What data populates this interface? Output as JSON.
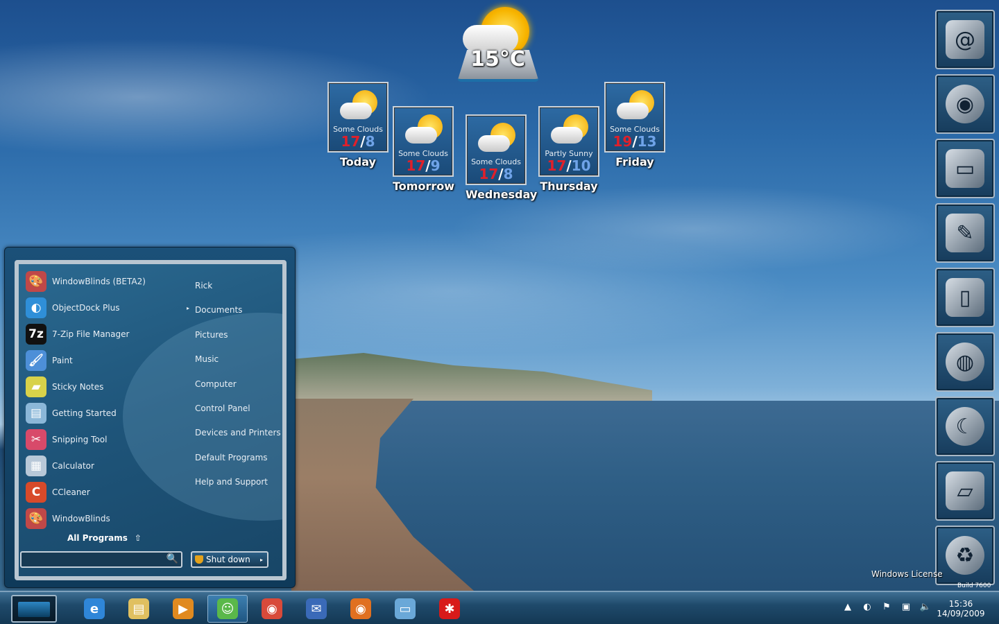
{
  "weather": {
    "current_temp": "15°C",
    "forecast": [
      {
        "condition": "Some Clouds",
        "high": "17",
        "low": "8",
        "day": "Today"
      },
      {
        "condition": "Some Clouds",
        "high": "17",
        "low": "9",
        "day": "Tomorrow"
      },
      {
        "condition": "Some Clouds",
        "high": "17",
        "low": "8",
        "day": "Wednesday"
      },
      {
        "condition": "Partly Sunny",
        "high": "17",
        "low": "10",
        "day": "Thursday"
      },
      {
        "condition": "Some Clouds",
        "high": "19",
        "low": "13",
        "day": "Friday"
      }
    ],
    "separator": "/"
  },
  "dock": {
    "items": [
      {
        "icon": "mail-icon",
        "glyph": "@"
      },
      {
        "icon": "firefox-icon",
        "glyph": "◉"
      },
      {
        "icon": "monitor-icon",
        "glyph": "▭"
      },
      {
        "icon": "pen-icon",
        "glyph": "✎"
      },
      {
        "icon": "door-icon",
        "glyph": "▯"
      },
      {
        "icon": "globe-icon",
        "glyph": "◍"
      },
      {
        "icon": "moon-orbs-icon",
        "glyph": "☾"
      },
      {
        "icon": "drive-icon",
        "glyph": "▱"
      },
      {
        "icon": "recycle-bin-icon",
        "glyph": "♻"
      }
    ]
  },
  "desktop": {
    "license_text": "Windows License",
    "build_text": "Build 7600"
  },
  "start_menu": {
    "apps": [
      {
        "label": "WindowBlinds (BETA2)",
        "icon": "windowblinds-icon",
        "glyph": "🎨",
        "color": "#c04848",
        "has_arrow": false
      },
      {
        "label": "ObjectDock Plus",
        "icon": "objectdock-icon",
        "glyph": "◐",
        "color": "#2f8fd8",
        "has_arrow": true
      },
      {
        "label": "7-Zip File Manager",
        "icon": "7zip-icon",
        "glyph": "7z",
        "color": "#111111",
        "has_arrow": false
      },
      {
        "label": "Paint",
        "icon": "paint-icon",
        "glyph": "🖌",
        "color": "#4d8fd8",
        "has_arrow": false
      },
      {
        "label": "Sticky Notes",
        "icon": "sticky-notes-icon",
        "glyph": "▰",
        "color": "#d8d24a",
        "has_arrow": false
      },
      {
        "label": "Getting Started",
        "icon": "getting-started-icon",
        "glyph": "▤",
        "color": "#8bb7d8",
        "has_arrow": false
      },
      {
        "label": "Snipping Tool",
        "icon": "snipping-tool-icon",
        "glyph": "✂",
        "color": "#d84a6a",
        "has_arrow": false
      },
      {
        "label": "Calculator",
        "icon": "calculator-icon",
        "glyph": "▦",
        "color": "#b8c8d8",
        "has_arrow": false
      },
      {
        "label": "CCleaner",
        "icon": "ccleaner-icon",
        "glyph": "C",
        "color": "#d84a2a",
        "has_arrow": false
      },
      {
        "label": "WindowBlinds",
        "icon": "windowblinds-icon",
        "glyph": "🎨",
        "color": "#c04848",
        "has_arrow": false
      }
    ],
    "all_programs": "All Programs",
    "all_programs_arrow": "⇧",
    "places": [
      "Rick",
      "Documents",
      "Pictures",
      "Music",
      "Computer",
      "Control Panel",
      "Devices and Printers",
      "Default Programs",
      "Help and Support"
    ],
    "search_value": "",
    "search_icon": "🔍",
    "shutdown_label": "Shut down",
    "shutdown_arrow": "▸",
    "submenu_arrow": "▸"
  },
  "taskbar": {
    "buttons": [
      {
        "icon": "internet-explorer-icon",
        "glyph": "e",
        "color": "#2f86d8",
        "active": false
      },
      {
        "icon": "file-explorer-icon",
        "glyph": "▤",
        "color": "#e0c060",
        "active": false
      },
      {
        "icon": "media-player-icon",
        "glyph": "▶",
        "color": "#e08a20",
        "active": false
      },
      {
        "icon": "messenger-icon",
        "glyph": "☺",
        "color": "#5ab84a",
        "active": true
      },
      {
        "icon": "chrome-icon",
        "glyph": "◉",
        "color": "#d84a3a",
        "active": false
      },
      {
        "icon": "thunderbird-icon",
        "glyph": "✉",
        "color": "#3a6ab8",
        "active": false
      },
      {
        "icon": "firefox-icon",
        "glyph": "◉",
        "color": "#e07020",
        "active": false
      },
      {
        "icon": "remote-desktop-icon",
        "glyph": "▭",
        "color": "#6aa8d8",
        "active": false
      },
      {
        "icon": "splat-icon",
        "glyph": "✱",
        "color": "#d81a1a",
        "active": false
      }
    ],
    "tray": [
      {
        "icon": "show-hidden-icon",
        "glyph": "▲"
      },
      {
        "icon": "objectdock-tray-icon",
        "glyph": "◐"
      },
      {
        "icon": "action-center-flag-icon",
        "glyph": "⚑"
      },
      {
        "icon": "network-icon",
        "glyph": "▣"
      },
      {
        "icon": "volume-icon",
        "glyph": "🔈"
      }
    ],
    "time": "15:36",
    "date": "14/09/2009"
  }
}
